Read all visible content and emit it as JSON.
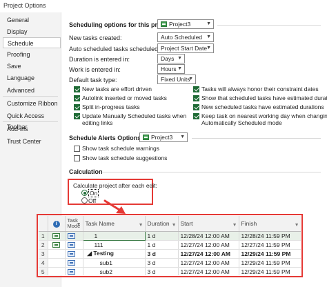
{
  "window": {
    "title": "Project Options"
  },
  "sidebar": {
    "items": [
      {
        "label": "General",
        "selected": false
      },
      {
        "label": "Display",
        "selected": false
      },
      {
        "label": "Schedule",
        "selected": true
      },
      {
        "label": "Proofing",
        "selected": false
      },
      {
        "label": "Save",
        "selected": false
      },
      {
        "label": "Language",
        "selected": false
      },
      {
        "label": "Advanced",
        "selected": false
      },
      {
        "label": "Customize Ribbon",
        "selected": false
      },
      {
        "label": "Quick Access Toolbar",
        "selected": false
      },
      {
        "label": "Add-ins",
        "selected": false
      },
      {
        "label": "Trust Center",
        "selected": false
      }
    ]
  },
  "scheduling": {
    "section_label": "Scheduling options for this project:",
    "project_select": "Project3",
    "new_tasks_label": "New tasks created:",
    "new_tasks_value": "Auto Scheduled",
    "auto_sched_label": "Auto scheduled tasks scheduled on:",
    "auto_sched_value": "Project Start Date",
    "duration_label": "Duration is entered in:",
    "duration_value": "Days",
    "work_label": "Work is entered in:",
    "work_value": "Hours",
    "task_type_label": "Default task type:",
    "task_type_value": "Fixed Units",
    "checkboxes_left": [
      {
        "label": "New tasks are effort driven",
        "checked": true
      },
      {
        "label": "Autolink inserted or moved tasks",
        "checked": true
      },
      {
        "label": "Split in-progress tasks",
        "checked": true
      },
      {
        "label": "Update Manually Scheduled tasks when",
        "label2": "editing links",
        "checked": true
      }
    ],
    "checkboxes_right": [
      {
        "label": "Tasks will always honor their constraint dates",
        "checked": true
      },
      {
        "label": "Show that scheduled tasks have estimated durations",
        "checked": true
      },
      {
        "label": "New scheduled tasks have estimated durations",
        "checked": true
      },
      {
        "label": "Keep task on nearest working day when changing to",
        "label2": "Automatically Scheduled mode",
        "checked": true
      }
    ]
  },
  "alerts": {
    "section_label": "Schedule Alerts Options:",
    "project_select": "Project3",
    "checkboxes": [
      {
        "label": "Show task schedule warnings",
        "checked": false
      },
      {
        "label": "Show task schedule suggestions",
        "checked": false
      }
    ]
  },
  "calculation": {
    "section_label": "Calculation",
    "prompt": "Calculate project after each edit:",
    "on_label": "On",
    "off_label": "Off",
    "selected": "On"
  },
  "grid": {
    "headers": {
      "info": "i",
      "task_mode": "Task Mode",
      "task_name": "Task Name",
      "duration": "Duration",
      "start": "Start",
      "finish": "Finish"
    },
    "rows": [
      {
        "id": "1",
        "name": "1",
        "duration": "1 d",
        "start": "12/28/24 12:00 AM",
        "finish": "12/28/24 11:59 PM",
        "summary": false,
        "indent": 1
      },
      {
        "id": "2",
        "name": "111",
        "duration": "1 d",
        "start": "12/27/24 12:00 AM",
        "finish": "12/27/24 11:59 PM",
        "summary": false,
        "indent": 1
      },
      {
        "id": "3",
        "name": "Testing",
        "duration": "3 d",
        "start": "12/27/24 12:00 AM",
        "finish": "12/29/24 11:59 PM",
        "summary": true,
        "indent": 0
      },
      {
        "id": "4",
        "name": "sub1",
        "duration": "3 d",
        "start": "12/27/24 12:00 AM",
        "finish": "12/29/24 11:59 PM",
        "summary": false,
        "indent": 2
      },
      {
        "id": "5",
        "name": "sub2",
        "duration": "3 d",
        "start": "12/27/24 12:00 AM",
        "finish": "12/29/24 11:59 PM",
        "summary": false,
        "indent": 2
      }
    ]
  },
  "colors": {
    "accent": "#1f6b36",
    "highlight": "#e53935",
    "task_icon": "#3d6fb6"
  }
}
